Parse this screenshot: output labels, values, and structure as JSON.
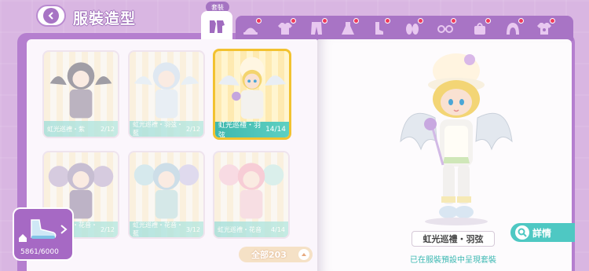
{
  "header": {
    "title": "服裝造型",
    "active_tab_label": "套裝"
  },
  "category_icons": [
    {
      "name": "outfit-set-icon",
      "active": true
    },
    {
      "name": "hat-icon",
      "dot": true
    },
    {
      "name": "top-icon",
      "dot": true
    },
    {
      "name": "pants-icon",
      "dot": true
    },
    {
      "name": "dress-icon",
      "dot": true
    },
    {
      "name": "socks-icon",
      "dot": true
    },
    {
      "name": "shoes-icon",
      "dot": true
    },
    {
      "name": "glasses-icon",
      "dot": true
    },
    {
      "name": "hair-icon",
      "dot": true
    },
    {
      "name": "shirt-icon",
      "dot": true
    }
  ],
  "outfits": [
    {
      "name": "虹光巡禮・紫",
      "progress": "2/12",
      "active": false
    },
    {
      "name": "虹光巡禮・羽弦・藍",
      "progress": "2/12",
      "active": false
    },
    {
      "name": "虹光巡禮・羽弦",
      "progress": "14/14",
      "active": true
    },
    {
      "name": "虹光巡禮・花音・紫",
      "progress": "2/12",
      "active": false
    },
    {
      "name": "虹光巡禮・花音・藍",
      "progress": "3/12",
      "active": false
    },
    {
      "name": "虹光巡禮・花音",
      "progress": "4/14",
      "active": false
    }
  ],
  "currency": {
    "value": "5861/6000"
  },
  "filter": {
    "label": "全部203"
  },
  "preview": {
    "outfit_name": "虹光巡禮・羽弦",
    "detail_label": "詳情",
    "preset_note": "已在服裝預設中呈現套裝"
  },
  "colors": {
    "background": "#d9b6e2",
    "accent_purple": "#a874c5",
    "teal": "#4ec8c3",
    "active_border": "#f2c230"
  }
}
